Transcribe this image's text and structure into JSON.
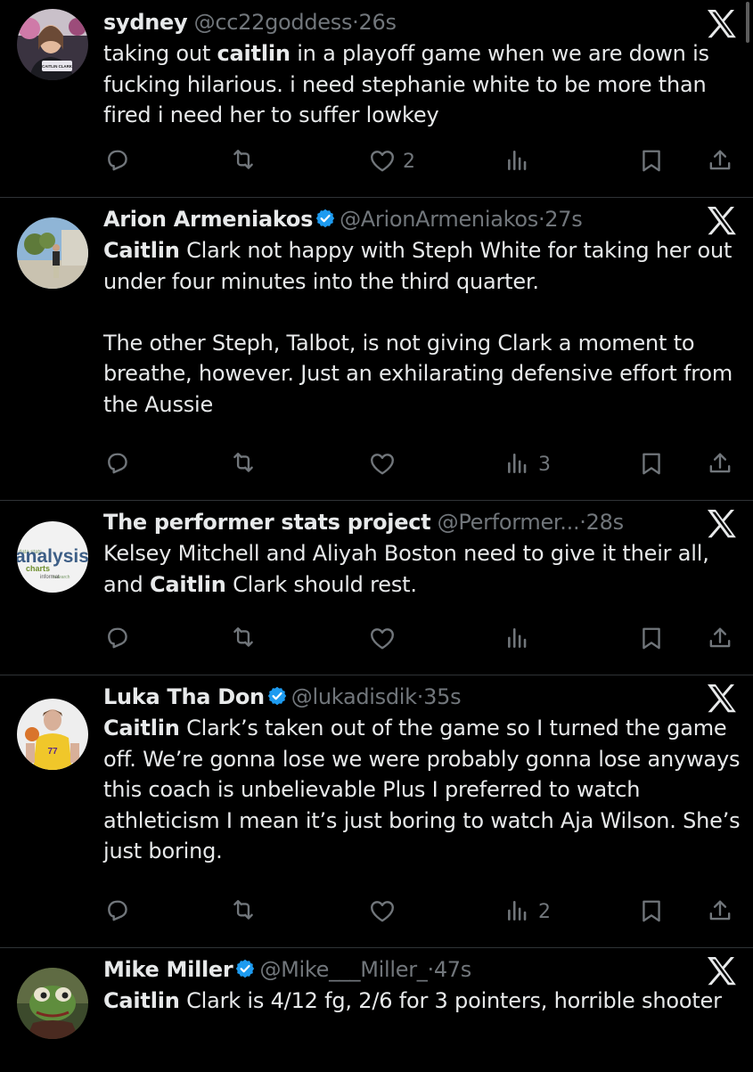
{
  "tweets": [
    {
      "name": "sydney",
      "verified": false,
      "handle": "@cc22goddess",
      "dot": "·",
      "time": "26s",
      "paragraphs": [
        [
          {
            "t": "taking out "
          },
          {
            "t": "caitlin",
            "b": true
          },
          {
            "t": " in a playoff game when we are down is fucking hilarious. i need stephanie white to be more than fired i need her to suffer lowkey"
          }
        ]
      ],
      "likes": "2",
      "views": ""
    },
    {
      "name": "Arion Armeniakos",
      "verified": true,
      "handle": "@ArionArmeniakos",
      "dot": "·",
      "time": "27s",
      "paragraphs": [
        [
          {
            "t": "Caitlin",
            "b": true
          },
          {
            "t": " Clark not happy with Steph White for taking her out under four minutes into the third quarter."
          }
        ],
        [
          {
            "t": "The other Steph, Talbot, is not giving Clark a moment to breathe, however. Just an exhilarating defensive effort from the Aussie"
          }
        ]
      ],
      "likes": "",
      "views": "3"
    },
    {
      "name": "The performer stats project",
      "verified": false,
      "handle": "@Performer...",
      "dot": "·",
      "time": "28s",
      "paragraphs": [
        [
          {
            "t": "Kelsey Mitchell and Aliyah Boston need to give it their all, and "
          },
          {
            "t": "Caitlin",
            "b": true
          },
          {
            "t": " Clark should rest."
          }
        ]
      ],
      "likes": "",
      "views": ""
    },
    {
      "name": "Luka Tha Don",
      "verified": true,
      "handle": "@lukadisdik",
      "dot": "·",
      "time": "35s",
      "paragraphs": [
        [
          {
            "t": "Caitlin",
            "b": true
          },
          {
            "t": " Clark’s taken out of the game so I turned the game off. We’re gonna lose we were probably gonna lose anyways this coach is unbelievable Plus I preferred to watch athleticism I mean it’s just boring to watch Aja Wilson. She’s just boring."
          }
        ]
      ],
      "likes": "",
      "views": "2"
    },
    {
      "name": "Mike Miller",
      "verified": true,
      "handle": "@Mike___Miller_",
      "dot": "·",
      "time": "47s",
      "paragraphs": [
        [
          {
            "t": "Caitlin",
            "b": true
          },
          {
            "t": " Clark is 4/12 fg, 2/6 for 3 pointers, horrible shooter"
          }
        ]
      ],
      "likes": "",
      "views": ""
    }
  ],
  "avatar_labels": {
    "sydney": "CAITLIN CLARK",
    "performer": [
      "analysis",
      "charts",
      "informat"
    ],
    "luka": "77"
  },
  "colors": {
    "background": "#000000",
    "text": "#e7e9ea",
    "muted": "#71767b",
    "divider": "#2f3336",
    "verified": "#1d9bf0"
  }
}
